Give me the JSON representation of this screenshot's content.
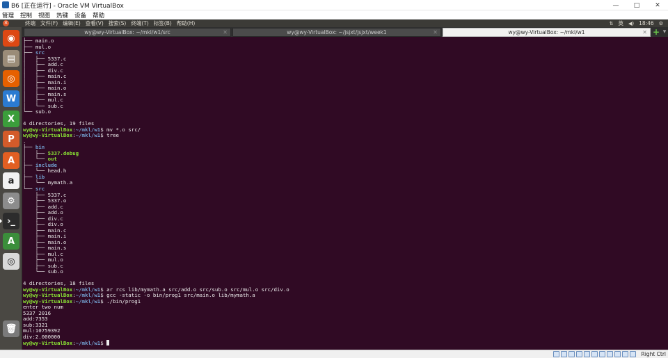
{
  "host": {
    "title": "B6 [正在运行] - Oracle VM VirtualBox",
    "controls": [
      "—",
      "□",
      "✕"
    ],
    "menu": [
      "管理",
      "控制",
      "视图",
      "热键",
      "设备",
      "帮助"
    ],
    "host_key": "Right Ctrl"
  },
  "guest": {
    "menu": [
      "终端",
      "文件(F)",
      "编辑(E)",
      "查看(V)",
      "搜索(S)",
      "终端(T)",
      "标签(B)",
      "帮助(H)"
    ],
    "tray": {
      "time": "18:46",
      "input": "英"
    },
    "launcher": [
      {
        "name": "dash-icon",
        "color": "#dd4814",
        "glyph": "◉"
      },
      {
        "name": "files-icon",
        "color": "#9a8c78",
        "glyph": "▤"
      },
      {
        "name": "firefox-icon",
        "color": "#e66000",
        "glyph": "◎"
      },
      {
        "name": "writer-icon",
        "color": "#2b7bd1",
        "glyph": "W"
      },
      {
        "name": "calc-icon",
        "color": "#3b9e3b",
        "glyph": "X"
      },
      {
        "name": "impress-icon",
        "color": "#d35b2a",
        "glyph": "P"
      },
      {
        "name": "software-center-icon",
        "color": "#e25f22",
        "glyph": "A"
      },
      {
        "name": "amazon-icon",
        "color": "#f2f2f2",
        "glyph": "a"
      },
      {
        "name": "settings-icon",
        "color": "#8c8c8c",
        "glyph": "⚙"
      },
      {
        "name": "terminal-icon",
        "color": "#2c2c2c",
        "glyph": "›_"
      },
      {
        "name": "updater-icon",
        "color": "#3b8e3b",
        "glyph": "A"
      },
      {
        "name": "disc-icon",
        "color": "#d9d9d9",
        "glyph": "◎"
      },
      {
        "name": "trash-icon",
        "color": "#7a7a7a",
        "glyph": "🗑"
      }
    ]
  },
  "tabs": [
    {
      "label": "wy@wy-VirtualBox: ~/mkl/w1/src",
      "active": false
    },
    {
      "label": "wy@wy-VirtualBox: ~/jsjxt/jsjxt/week1",
      "active": false
    },
    {
      "label": "wy@wy-VirtualBox: ~/mkl/w1",
      "active": true
    }
  ],
  "terminal": {
    "lines": [
      [
        {
          "t": "├── ",
          "c": "tl"
        },
        {
          "t": "main.o",
          "c": "t-text"
        }
      ],
      [
        {
          "t": "├── ",
          "c": "tl"
        },
        {
          "t": "mul.o",
          "c": "t-text"
        }
      ],
      [
        {
          "t": "├── ",
          "c": "tl"
        },
        {
          "t": "src",
          "c": "t-dir"
        }
      ],
      [
        {
          "t": "│   ├── ",
          "c": "tl"
        },
        {
          "t": "5337.c",
          "c": "t-text"
        }
      ],
      [
        {
          "t": "│   ├── ",
          "c": "tl"
        },
        {
          "t": "add.c",
          "c": "t-text"
        }
      ],
      [
        {
          "t": "│   ├── ",
          "c": "tl"
        },
        {
          "t": "div.c",
          "c": "t-text"
        }
      ],
      [
        {
          "t": "│   ├── ",
          "c": "tl"
        },
        {
          "t": "main.c",
          "c": "t-text"
        }
      ],
      [
        {
          "t": "│   ├── ",
          "c": "tl"
        },
        {
          "t": "main.i",
          "c": "t-text"
        }
      ],
      [
        {
          "t": "│   ├── ",
          "c": "tl"
        },
        {
          "t": "main.o",
          "c": "t-text"
        }
      ],
      [
        {
          "t": "│   ├── ",
          "c": "tl"
        },
        {
          "t": "main.s",
          "c": "t-text"
        }
      ],
      [
        {
          "t": "│   ├── ",
          "c": "tl"
        },
        {
          "t": "mul.c",
          "c": "t-text"
        }
      ],
      [
        {
          "t": "│   └── ",
          "c": "tl"
        },
        {
          "t": "sub.c",
          "c": "t-text"
        }
      ],
      [
        {
          "t": "└── ",
          "c": "tl"
        },
        {
          "t": "sub.o",
          "c": "t-text"
        }
      ],
      [
        {
          "t": "",
          "c": "t-text"
        }
      ],
      [
        {
          "t": "4 directories, 19 files",
          "c": "t-text"
        }
      ],
      [
        {
          "t": "wy@wy-VirtualBox",
          "c": "t-prompt"
        },
        {
          "t": ":",
          "c": "t-text"
        },
        {
          "t": "~/mkl/w1",
          "c": "t-path"
        },
        {
          "t": "$ mv *.o src/",
          "c": "t-text"
        }
      ],
      [
        {
          "t": "wy@wy-VirtualBox",
          "c": "t-prompt"
        },
        {
          "t": ":",
          "c": "t-text"
        },
        {
          "t": "~/mkl/w1",
          "c": "t-path"
        },
        {
          "t": "$ tree",
          "c": "t-text"
        }
      ],
      [
        {
          "t": ".",
          "c": "t-text"
        }
      ],
      [
        {
          "t": "├── ",
          "c": "tl"
        },
        {
          "t": "bin",
          "c": "t-dir"
        }
      ],
      [
        {
          "t": "│   ├── ",
          "c": "tl"
        },
        {
          "t": "5337.debug",
          "c": "t-exec"
        }
      ],
      [
        {
          "t": "│   └── ",
          "c": "tl"
        },
        {
          "t": "out",
          "c": "t-exec"
        }
      ],
      [
        {
          "t": "├── ",
          "c": "tl"
        },
        {
          "t": "include",
          "c": "t-dir"
        }
      ],
      [
        {
          "t": "│   └── ",
          "c": "tl"
        },
        {
          "t": "head.h",
          "c": "t-text"
        }
      ],
      [
        {
          "t": "├── ",
          "c": "tl"
        },
        {
          "t": "lib",
          "c": "t-dir"
        }
      ],
      [
        {
          "t": "│   └── ",
          "c": "tl"
        },
        {
          "t": "mymath.a",
          "c": "t-text"
        }
      ],
      [
        {
          "t": "└── ",
          "c": "tl"
        },
        {
          "t": "src",
          "c": "t-dir"
        }
      ],
      [
        {
          "t": "    ├── ",
          "c": "tl"
        },
        {
          "t": "5337.c",
          "c": "t-text"
        }
      ],
      [
        {
          "t": "    ├── ",
          "c": "tl"
        },
        {
          "t": "5337.o",
          "c": "t-text"
        }
      ],
      [
        {
          "t": "    ├── ",
          "c": "tl"
        },
        {
          "t": "add.c",
          "c": "t-text"
        }
      ],
      [
        {
          "t": "    ├── ",
          "c": "tl"
        },
        {
          "t": "add.o",
          "c": "t-text"
        }
      ],
      [
        {
          "t": "    ├── ",
          "c": "tl"
        },
        {
          "t": "div.c",
          "c": "t-text"
        }
      ],
      [
        {
          "t": "    ├── ",
          "c": "tl"
        },
        {
          "t": "div.o",
          "c": "t-text"
        }
      ],
      [
        {
          "t": "    ├── ",
          "c": "tl"
        },
        {
          "t": "main.c",
          "c": "t-text"
        }
      ],
      [
        {
          "t": "    ├── ",
          "c": "tl"
        },
        {
          "t": "main.i",
          "c": "t-text"
        }
      ],
      [
        {
          "t": "    ├── ",
          "c": "tl"
        },
        {
          "t": "main.o",
          "c": "t-text"
        }
      ],
      [
        {
          "t": "    ├── ",
          "c": "tl"
        },
        {
          "t": "main.s",
          "c": "t-text"
        }
      ],
      [
        {
          "t": "    ├── ",
          "c": "tl"
        },
        {
          "t": "mul.c",
          "c": "t-text"
        }
      ],
      [
        {
          "t": "    ├── ",
          "c": "tl"
        },
        {
          "t": "mul.o",
          "c": "t-text"
        }
      ],
      [
        {
          "t": "    ├── ",
          "c": "tl"
        },
        {
          "t": "sub.c",
          "c": "t-text"
        }
      ],
      [
        {
          "t": "    └── ",
          "c": "tl"
        },
        {
          "t": "sub.o",
          "c": "t-text"
        }
      ],
      [
        {
          "t": "",
          "c": "t-text"
        }
      ],
      [
        {
          "t": "4 directories, 18 files",
          "c": "t-text"
        }
      ],
      [
        {
          "t": "wy@wy-VirtualBox",
          "c": "t-prompt"
        },
        {
          "t": ":",
          "c": "t-text"
        },
        {
          "t": "~/mkl/w1",
          "c": "t-path"
        },
        {
          "t": "$ ar rcs lib/mymath.a src/add.o src/sub.o src/mul.o src/div.o",
          "c": "t-text"
        }
      ],
      [
        {
          "t": "wy@wy-VirtualBox",
          "c": "t-prompt"
        },
        {
          "t": ":",
          "c": "t-text"
        },
        {
          "t": "~/mkl/w1",
          "c": "t-path"
        },
        {
          "t": "$ gcc -static -o bin/prog1 src/main.o lib/mymath.a",
          "c": "t-text"
        }
      ],
      [
        {
          "t": "wy@wy-VirtualBox",
          "c": "t-prompt"
        },
        {
          "t": ":",
          "c": "t-text"
        },
        {
          "t": "~/mkl/w1",
          "c": "t-path"
        },
        {
          "t": "$ ./bin/prog1",
          "c": "t-text"
        }
      ],
      [
        {
          "t": "enter two num",
          "c": "t-text"
        }
      ],
      [
        {
          "t": "5337 2016",
          "c": "t-text"
        }
      ],
      [
        {
          "t": "add:7353",
          "c": "t-text"
        }
      ],
      [
        {
          "t": "sub:3321",
          "c": "t-text"
        }
      ],
      [
        {
          "t": "mul:10759392",
          "c": "t-text"
        }
      ],
      [
        {
          "t": "div:2.000000",
          "c": "t-text"
        }
      ],
      [
        {
          "t": "wy@wy-VirtualBox",
          "c": "t-prompt"
        },
        {
          "t": ":",
          "c": "t-text"
        },
        {
          "t": "~/mkl/w1",
          "c": "t-path"
        },
        {
          "t": "$ ",
          "c": "t-text"
        }
      ]
    ]
  }
}
